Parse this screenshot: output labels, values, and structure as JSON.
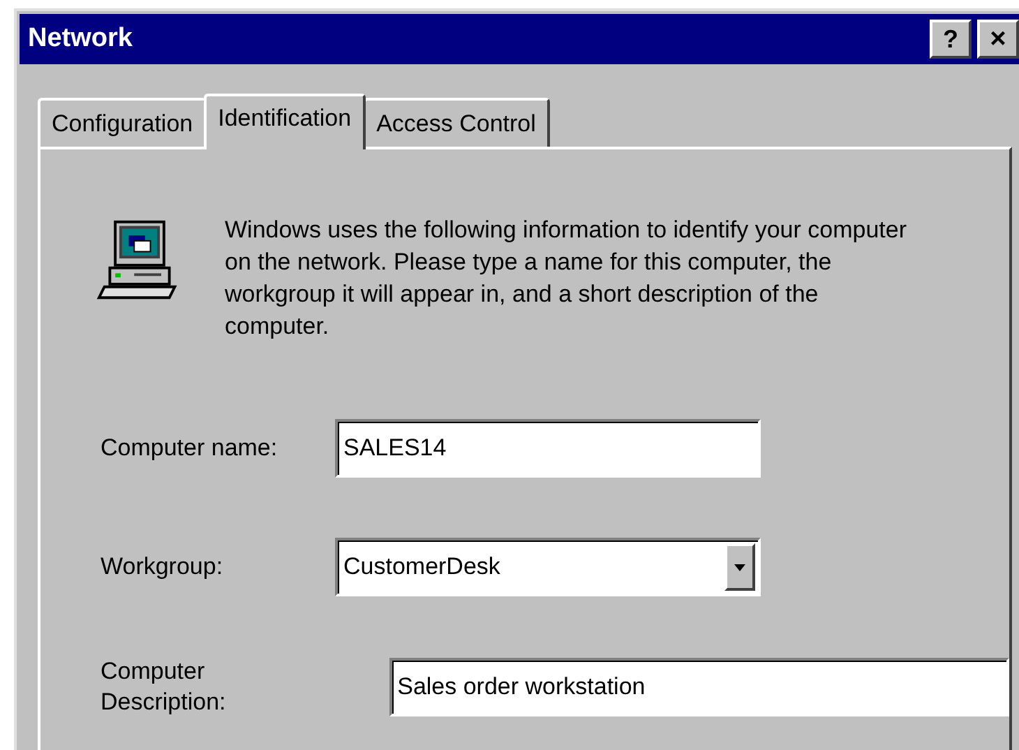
{
  "window": {
    "title": "Network",
    "help_button": "?",
    "close_button": "×"
  },
  "tabs": [
    {
      "label": "Configuration",
      "selected": false
    },
    {
      "label": "Identification",
      "selected": true
    },
    {
      "label": "Access Control",
      "selected": false
    }
  ],
  "intro": "Windows uses the following information to identify your computer on the network.  Please type a name for this computer, the workgroup it will appear in, and a short description of the computer.",
  "fields": [
    {
      "kind": "text",
      "label": "Computer name:",
      "value": "SALES14"
    },
    {
      "kind": "dropdown",
      "label": "Workgroup:",
      "value": "CustomerDesk"
    },
    {
      "kind": "text",
      "label": "Computer Description:",
      "value": "Sales order workstation"
    }
  ]
}
